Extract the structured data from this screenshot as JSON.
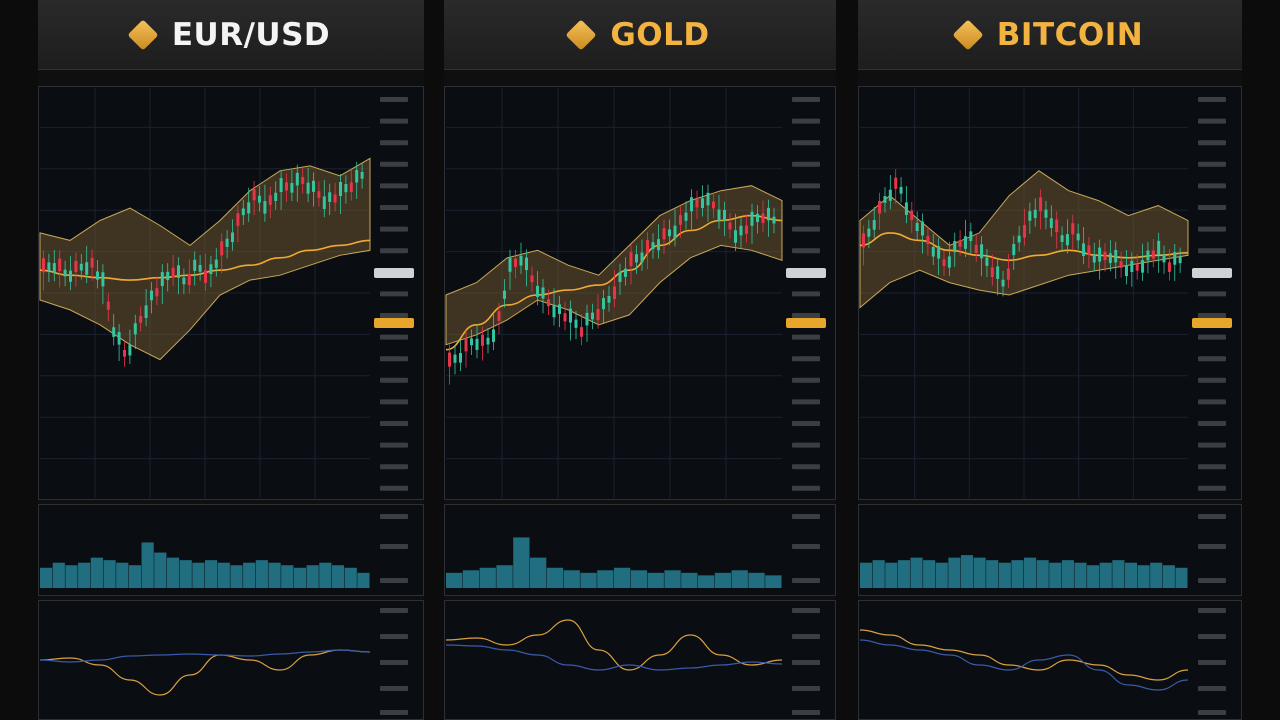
{
  "colors": {
    "up": "#35c4a0",
    "down": "#e8344a",
    "band": "#6b5530",
    "band_edge": "#c9a85a",
    "ma": "#f2a930",
    "eurusd_title": "#f4f4f4",
    "gold_title": "#f2b340",
    "bitcoin_title": "#f2b340",
    "volume": "#2a8fa6",
    "osc_a": "#d9a040",
    "osc_b": "#3a5aa8"
  },
  "panels": [
    {
      "key": "eurusd",
      "title": "EUR/USD",
      "icon": "diamond-icon",
      "chart_data": {
        "type": "line",
        "title": "EUR/USD",
        "price_path": [
          0.5,
          0.48,
          0.52,
          0.49,
          0.47,
          0.55,
          0.75,
          0.85,
          0.72,
          0.62,
          0.56,
          0.5,
          0.55,
          0.48,
          0.52,
          0.44,
          0.36,
          0.26,
          0.2,
          0.24,
          0.18,
          0.16,
          0.14,
          0.18,
          0.22,
          0.2,
          0.16,
          0.12
        ],
        "band_upper": [
          0.35,
          0.38,
          0.3,
          0.25,
          0.32,
          0.4,
          0.3,
          0.18,
          0.1,
          0.08,
          0.12,
          0.05
        ],
        "band_lower": [
          0.62,
          0.66,
          0.72,
          0.8,
          0.86,
          0.74,
          0.6,
          0.54,
          0.52,
          0.48,
          0.44,
          0.42
        ],
        "ma": [
          0.5,
          0.52,
          0.53,
          0.54,
          0.53,
          0.52,
          0.5,
          0.48,
          0.45,
          0.42,
          0.4,
          0.38
        ],
        "volume": [
          0.4,
          0.5,
          0.45,
          0.5,
          0.6,
          0.55,
          0.5,
          0.45,
          0.9,
          0.7,
          0.6,
          0.55,
          0.5,
          0.55,
          0.5,
          0.45,
          0.5,
          0.55,
          0.5,
          0.45,
          0.4,
          0.45,
          0.5,
          0.45,
          0.4,
          0.3
        ],
        "osc_a": [
          0.5,
          0.48,
          0.55,
          0.7,
          0.85,
          0.65,
          0.45,
          0.5,
          0.6,
          0.45,
          0.4,
          0.42
        ],
        "osc_b": [
          0.5,
          0.52,
          0.5,
          0.46,
          0.45,
          0.44,
          0.45,
          0.46,
          0.44,
          0.42,
          0.4,
          0.42
        ]
      }
    },
    {
      "key": "gold",
      "title": "GOLD",
      "icon": "diamond-icon",
      "chart_data": {
        "type": "line",
        "title": "GOLD",
        "price_path": [
          0.88,
          0.84,
          0.78,
          0.8,
          0.72,
          0.5,
          0.45,
          0.55,
          0.62,
          0.66,
          0.7,
          0.74,
          0.68,
          0.64,
          0.55,
          0.48,
          0.44,
          0.4,
          0.36,
          0.32,
          0.26,
          0.22,
          0.24,
          0.3,
          0.36,
          0.32,
          0.28,
          0.3
        ],
        "band_upper": [
          0.6,
          0.55,
          0.45,
          0.42,
          0.48,
          0.52,
          0.4,
          0.28,
          0.22,
          0.18,
          0.16,
          0.22
        ],
        "band_lower": [
          0.8,
          0.76,
          0.7,
          0.62,
          0.66,
          0.72,
          0.68,
          0.55,
          0.45,
          0.4,
          0.42,
          0.46
        ],
        "ma": [
          0.82,
          0.72,
          0.64,
          0.6,
          0.58,
          0.56,
          0.5,
          0.4,
          0.34,
          0.3,
          0.28,
          0.3
        ],
        "volume": [
          0.3,
          0.35,
          0.4,
          0.45,
          1.0,
          0.6,
          0.4,
          0.35,
          0.3,
          0.35,
          0.4,
          0.35,
          0.3,
          0.35,
          0.3,
          0.25,
          0.3,
          0.35,
          0.3,
          0.25
        ],
        "osc_a": [
          0.3,
          0.28,
          0.35,
          0.25,
          0.1,
          0.4,
          0.6,
          0.45,
          0.25,
          0.45,
          0.55,
          0.5
        ],
        "osc_b": [
          0.35,
          0.36,
          0.4,
          0.45,
          0.55,
          0.6,
          0.55,
          0.6,
          0.58,
          0.55,
          0.52,
          0.54
        ]
      }
    },
    {
      "key": "bitcoin",
      "title": "BITCOIN",
      "icon": "diamond-icon",
      "chart_data": {
        "type": "line",
        "title": "BITCOIN",
        "price_path": [
          0.4,
          0.3,
          0.2,
          0.15,
          0.28,
          0.35,
          0.42,
          0.48,
          0.4,
          0.36,
          0.44,
          0.5,
          0.56,
          0.4,
          0.3,
          0.25,
          0.3,
          0.38,
          0.34,
          0.42,
          0.46,
          0.44,
          0.48,
          0.5,
          0.46,
          0.42,
          0.48,
          0.46
        ],
        "band_upper": [
          0.3,
          0.2,
          0.3,
          0.4,
          0.35,
          0.2,
          0.1,
          0.18,
          0.22,
          0.28,
          0.24,
          0.3
        ],
        "band_lower": [
          0.65,
          0.55,
          0.5,
          0.55,
          0.58,
          0.6,
          0.56,
          0.52,
          0.5,
          0.48,
          0.46,
          0.44
        ],
        "ma": [
          0.4,
          0.35,
          0.38,
          0.42,
          0.44,
          0.46,
          0.44,
          0.42,
          0.44,
          0.45,
          0.44,
          0.43
        ],
        "volume": [
          0.5,
          0.55,
          0.5,
          0.55,
          0.6,
          0.55,
          0.5,
          0.6,
          0.65,
          0.6,
          0.55,
          0.5,
          0.55,
          0.6,
          0.55,
          0.5,
          0.55,
          0.5,
          0.45,
          0.5,
          0.55,
          0.5,
          0.45,
          0.5,
          0.45,
          0.4
        ],
        "osc_a": [
          0.2,
          0.25,
          0.35,
          0.4,
          0.45,
          0.55,
          0.6,
          0.5,
          0.55,
          0.65,
          0.7,
          0.6
        ],
        "osc_b": [
          0.3,
          0.35,
          0.4,
          0.45,
          0.55,
          0.6,
          0.5,
          0.45,
          0.6,
          0.75,
          0.8,
          0.7
        ]
      }
    }
  ]
}
